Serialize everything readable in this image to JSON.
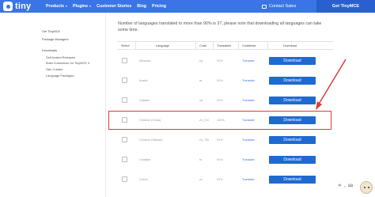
{
  "header": {
    "logo_text": "tiny",
    "nav": [
      {
        "label": "Products",
        "has_caret": true
      },
      {
        "label": "Plugins",
        "has_caret": true
      },
      {
        "label": "Customer Stories",
        "has_caret": false
      },
      {
        "label": "Blog",
        "has_caret": false
      },
      {
        "label": "Pricing",
        "has_caret": false
      }
    ],
    "contact_label": "Contact Sales",
    "cta_label": "Get TinyMCE"
  },
  "sidebar": {
    "items": [
      {
        "label": "Get TinyMCE"
      },
      {
        "label": "Package Managers"
      },
      {
        "label": "Downloads"
      },
      {
        "label": "Self-hosted Releases"
      },
      {
        "label": "Build Customizer for TinyMCE 4"
      },
      {
        "label": "Skin Creator"
      },
      {
        "label": "Language Packages"
      }
    ]
  },
  "intro_text": "Number of languages translated to more than 90% is 37, please note that downloading all languages can take some time.",
  "table": {
    "headers": [
      "Select",
      "Language",
      "Code",
      "Translated",
      "Contribute",
      "Download"
    ],
    "rows": [
      {
        "language": "Albanian",
        "code": "sq",
        "translated": "91%",
        "contribute": "Translate",
        "download": "Download"
      },
      {
        "language": "Arabic",
        "code": "ar",
        "translated": "91%",
        "contribute": "Translate",
        "download": "Download"
      },
      {
        "language": "Catalan",
        "code": "ca",
        "translated": "91%",
        "contribute": "Translate",
        "download": "Download"
      },
      {
        "language": "Chinese (China)",
        "code": "zh_CN",
        "translated": "100%",
        "contribute": "Translate",
        "download": "Download"
      },
      {
        "language": "Chinese (Taiwan)",
        "code": "zh_TW",
        "translated": "91%",
        "contribute": "Translate",
        "download": "Download"
      },
      {
        "language": "Croatian",
        "code": "hr",
        "translated": "91%",
        "contribute": "Translate",
        "download": "Download"
      },
      {
        "language": "Czech",
        "code": "cs",
        "translated": "91%",
        "contribute": "Translate",
        "download": "Download"
      }
    ]
  },
  "bottom_icons": [
    "中",
    "♪",
    "⌨"
  ],
  "colors": {
    "brand": "#3a74e6",
    "cta": "#2a5fd0",
    "download_button": "#1f6ad1",
    "highlight": "#dd3b3b",
    "link": "#3a74e6"
  }
}
